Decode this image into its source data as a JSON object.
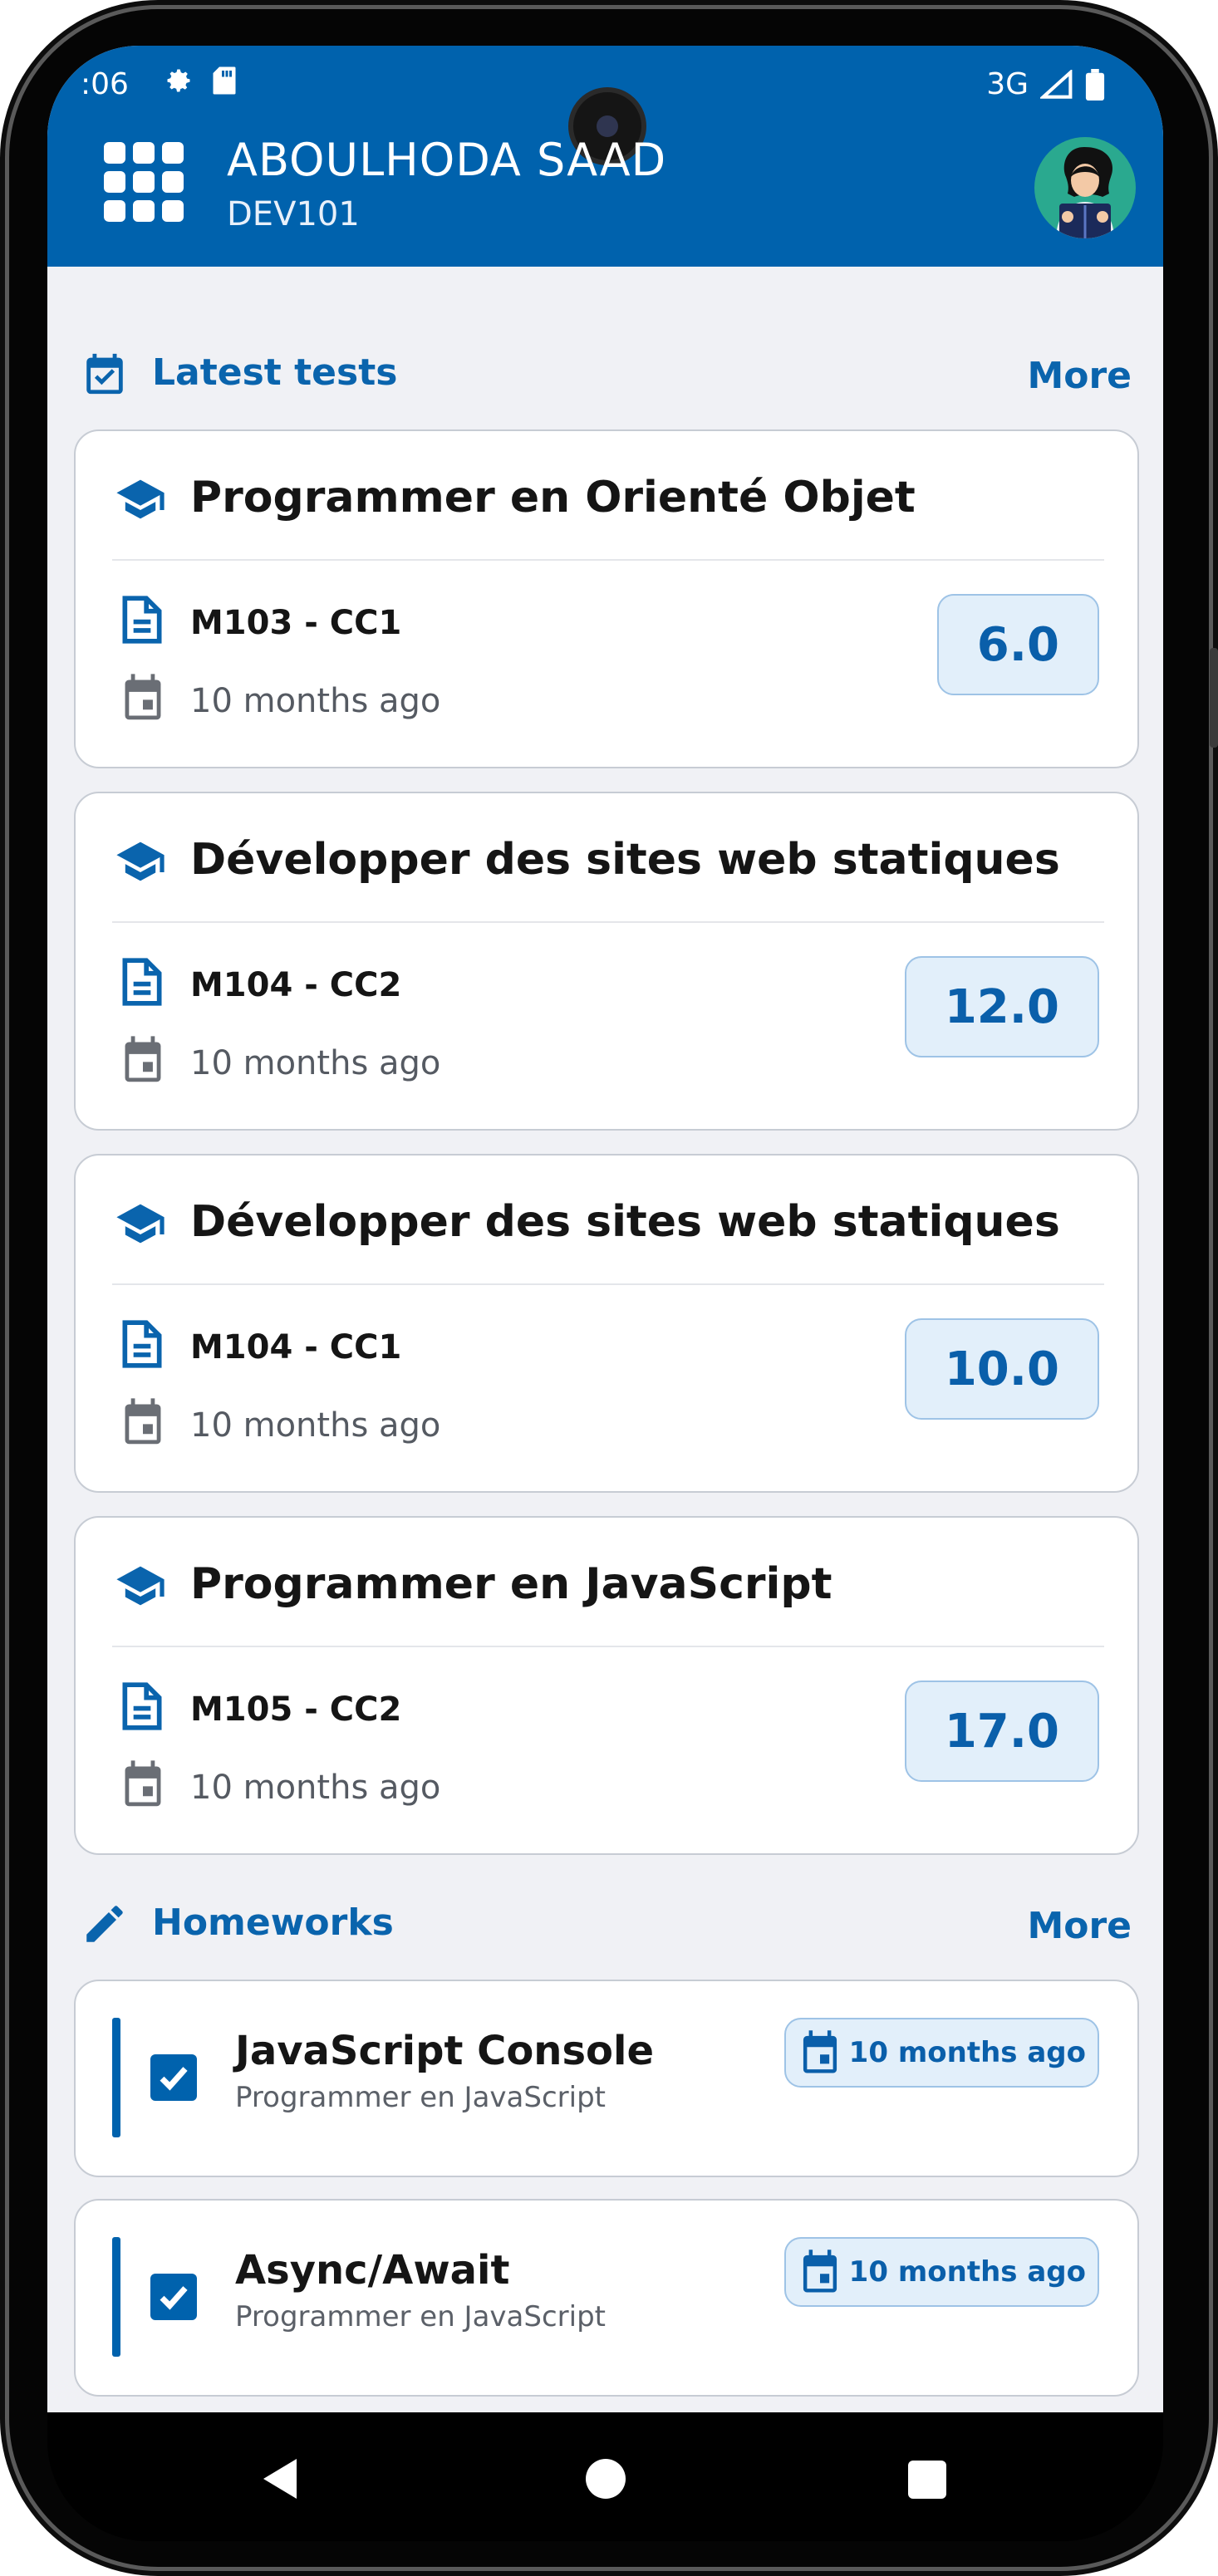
{
  "status_bar": {
    "time": ":06",
    "network": "3G"
  },
  "header": {
    "name": "ABOULHODA SAAD",
    "group": "DEV101"
  },
  "tests_section": {
    "title": "Latest tests",
    "more_label": "More",
    "items": [
      {
        "subject": "Programmer en Orienté Objet",
        "code": "M103 - CC1",
        "date": "10 months ago",
        "grade": "6.0"
      },
      {
        "subject": "Développer des sites web statiques",
        "code": "M104 - CC2",
        "date": "10 months ago",
        "grade": "12.0"
      },
      {
        "subject": "Développer des sites web statiques",
        "code": "M104 - CC1",
        "date": "10 months ago",
        "grade": "10.0"
      },
      {
        "subject": "Programmer en JavaScript",
        "code": "M105 - CC2",
        "date": "10 months ago",
        "grade": "17.0"
      }
    ]
  },
  "homeworks_section": {
    "title": "Homeworks",
    "more_label": "More",
    "items": [
      {
        "title": "JavaScript Console",
        "module": "Programmer en JavaScript",
        "due": "10 months ago",
        "done": true
      },
      {
        "title": "Async/Await",
        "module": "Programmer en JavaScript",
        "due": "10 months ago",
        "done": true
      }
    ]
  },
  "colors": {
    "primary": "#0062ad",
    "background": "#f0f1f5",
    "grade_bg": "#e2effa"
  },
  "icons": [
    "apps-grid-icon",
    "graduation-cap-icon",
    "document-icon",
    "calendar-icon",
    "calendar-check-icon",
    "pencil-icon",
    "checkbox-checked-icon"
  ]
}
